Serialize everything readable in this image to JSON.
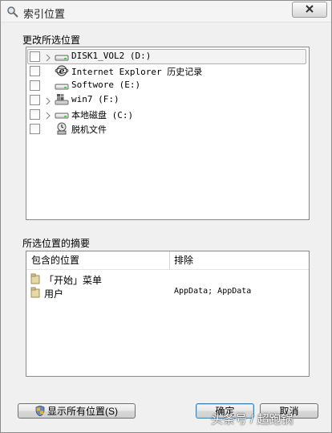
{
  "window": {
    "title": "索引位置",
    "close_icon": "close-icon"
  },
  "change_group": {
    "label": "更改所选位置",
    "items": [
      {
        "label": "DISK1_VOL2 (D:)",
        "icon": "drive-icon",
        "expandable": true,
        "selected": true
      },
      {
        "label": "Internet Explorer 历史记录",
        "icon": "ie-icon",
        "expandable": false,
        "selected": false
      },
      {
        "label": "Softwore (E:)",
        "icon": "drive-icon",
        "expandable": false,
        "selected": false
      },
      {
        "label": "win7 (F:)",
        "icon": "windows-drive-icon",
        "expandable": true,
        "selected": false
      },
      {
        "label": "本地磁盘 (C:)",
        "icon": "drive-icon",
        "expandable": true,
        "selected": false
      },
      {
        "label": "脱机文件",
        "icon": "offline-files-icon",
        "expandable": false,
        "selected": false
      }
    ]
  },
  "summary_group": {
    "label": "所选位置的摘要",
    "columns": {
      "included": "包含的位置",
      "excluded": "排除"
    },
    "rows": [
      {
        "included": "「开始」菜单",
        "excluded": ""
      },
      {
        "included": "用户",
        "excluded": "AppData; AppData"
      }
    ]
  },
  "buttons": {
    "show_all": "显示所有位置(S)",
    "ok": "确定",
    "cancel": "取消"
  },
  "watermark": "头条号 / 超跑锅"
}
